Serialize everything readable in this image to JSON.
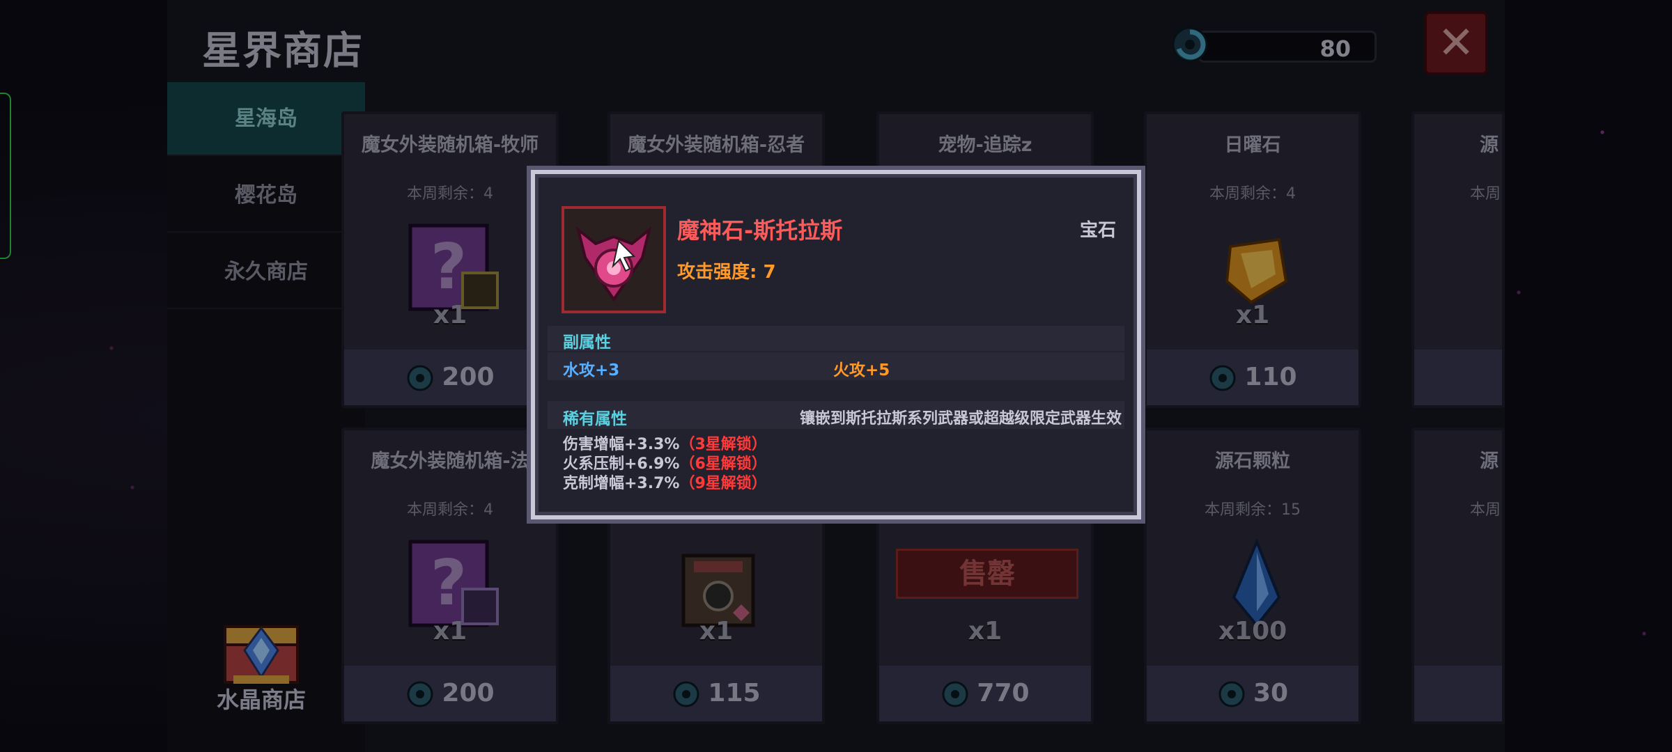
{
  "shop": {
    "title": "星界商店",
    "currency_amount": "80",
    "close_symbol": "✕"
  },
  "sidebar": {
    "tabs": [
      {
        "label": "星海岛",
        "active": true
      },
      {
        "label": "樱花岛",
        "active": false
      },
      {
        "label": "永久商店",
        "active": false
      }
    ],
    "crystal_shop_label": "水晶商店"
  },
  "cards": [
    {
      "name": "魔女外装随机箱-牧师",
      "remain": "本周剩余：4",
      "qty": "x1",
      "price": "200"
    },
    {
      "name": "魔女外装随机箱-忍者",
      "remain": "",
      "qty": "",
      "price": ""
    },
    {
      "name": "宠物-追踪z",
      "remain": "",
      "qty": "",
      "price": ""
    },
    {
      "name": "日曜石",
      "remain": "本周剩余：4",
      "qty": "x1",
      "price": "110"
    },
    {
      "name": "源",
      "remain": "本周",
      "qty": "",
      "price": ""
    },
    {
      "name": "魔女外装随机箱-法",
      "remain": "本周剩余：4",
      "qty": "x1",
      "price": "200"
    },
    {
      "name": "",
      "remain": "",
      "qty": "x1",
      "price": "115"
    },
    {
      "name": "",
      "remain": "",
      "qty": "x1",
      "price": "770",
      "sold_label": "售罄"
    },
    {
      "name": "源石颗粒",
      "remain": "本周剩余：15",
      "qty": "x100",
      "price": "30"
    },
    {
      "name": "源",
      "remain": "本周",
      "qty": "",
      "price": ""
    }
  ],
  "tooltip": {
    "name": "魔神石-斯托拉斯",
    "type": "宝石",
    "attack": "攻击强度: 7",
    "sub_header": "副属性",
    "sub_attrs": [
      "水攻+3",
      "火攻+5"
    ],
    "rare_header": "稀有属性",
    "rare_note": "镶嵌到斯托拉斯系列武器或超越级限定武器生效",
    "rare_attrs": [
      {
        "text": "伤害增幅+3.3%",
        "lock": "（3星解锁）"
      },
      {
        "text": "火系压制+6.9%",
        "lock": "（6星解锁）"
      },
      {
        "text": "克制增幅+3.7%",
        "lock": "（9星解锁）"
      }
    ]
  },
  "colors": {
    "active_tab": "#134449",
    "item_name": "#ff5a5a",
    "attack": "#ff9a2a",
    "water": "#5ab0ff",
    "lock": "#ff3a3a"
  }
}
